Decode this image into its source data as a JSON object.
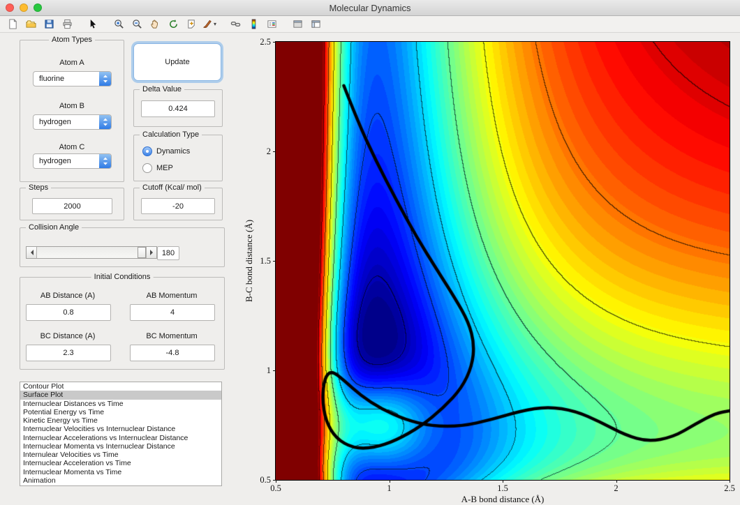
{
  "window": {
    "title": "Molecular Dynamics"
  },
  "toolbar": {
    "items": [
      {
        "name": "new-figure"
      },
      {
        "name": "open-file"
      },
      {
        "name": "save-figure"
      },
      {
        "name": "print-figure"
      },
      {
        "sep": true
      },
      {
        "name": "edit-plot"
      },
      {
        "sep": true
      },
      {
        "name": "zoom-in"
      },
      {
        "name": "zoom-out"
      },
      {
        "name": "pan"
      },
      {
        "name": "rotate-3d"
      },
      {
        "name": "data-cursor"
      },
      {
        "name": "brush",
        "caret": true
      },
      {
        "sep": true
      },
      {
        "name": "link-plots"
      },
      {
        "name": "insert-colorbar"
      },
      {
        "name": "insert-legend"
      },
      {
        "sep": true
      },
      {
        "name": "hide-plot-tools"
      },
      {
        "name": "show-plot-tools"
      }
    ]
  },
  "panels": {
    "atom_types": {
      "title": "Atom Types",
      "fields": [
        {
          "label": "Atom A",
          "value": "fluorine"
        },
        {
          "label": "Atom B",
          "value": "hydrogen"
        },
        {
          "label": "Atom C",
          "value": "hydrogen"
        }
      ]
    },
    "update_button": "Update",
    "delta": {
      "title": "Delta Value",
      "value": "0.424"
    },
    "calculation_type": {
      "title": "Calculation Type",
      "options": [
        {
          "label": "Dynamics",
          "selected": true
        },
        {
          "label": "MEP",
          "selected": false
        }
      ]
    },
    "steps": {
      "title": "Steps",
      "value": "2000"
    },
    "cutoff": {
      "title": "Cutoff (Kcal/ mol)",
      "value": "-20"
    },
    "collision_angle": {
      "title": "Collision Angle",
      "value": "180"
    },
    "initial_conditions": {
      "title": "Initial Conditions",
      "fields": [
        {
          "label": "AB Distance (A)",
          "value": "0.8"
        },
        {
          "label": "AB Momentum",
          "value": "4"
        },
        {
          "label": "BC Distance (A)",
          "value": "2.3"
        },
        {
          "label": "BC Momentum",
          "value": "-4.8"
        }
      ]
    },
    "plot_list": {
      "selected_index": 1,
      "items": [
        "Contour Plot",
        "Surface Plot",
        "Internuclear Distances vs Time",
        "Potential Energy vs Time",
        "Kinetic Energy vs Time",
        "Internuclear Velocities vs Internuclear Distance",
        "Internuclear Accelerations vs Internuclear Distance",
        "Internuclear Momenta vs Internuclear Distance",
        "Internulear Velocities vs Time",
        "Internuclear Acceleration vs Time",
        "Internuclear Momenta vs Time",
        "Animation"
      ]
    }
  },
  "chart_data": {
    "type": "heatmap",
    "style": "filled-contour-with-trajectory",
    "title": "",
    "xlabel": "A-B bond distance (Å)",
    "ylabel": "B-C bond distance (Å)",
    "xlim": [
      0.5,
      2.5
    ],
    "ylim": [
      0.5,
      2.5
    ],
    "xticks": [
      "0.5",
      "1",
      "1.5",
      "2",
      "2.5"
    ],
    "yticks": [
      "0.5",
      "1",
      "1.5",
      "2",
      "2.5"
    ],
    "colormap": "jet",
    "grid": false,
    "fill_bands": 48,
    "line_levels": [
      -180,
      -150,
      -120,
      -90,
      -60,
      -30,
      0
    ],
    "potential_model": {
      "description": "LEPS-like reactive potential energy surface: deep product valley along x≈0.95, shallower entrance valley along y≈0.74, repulsive walls at small distances, high plateau at large x and y, saddle near the corner",
      "D1": 140,
      "r1": 0.95,
      "a1": 3.0,
      "D2": 80,
      "r2": 0.74,
      "a2": 1.7,
      "barrier": 110,
      "sx": 0.17,
      "sy": 0.17,
      "tilt": 18,
      "vmin": -190,
      "vmax": 20
    },
    "trajectory": {
      "color": "#000000",
      "line_width": 4.5,
      "points": [
        [
          0.8,
          2.3
        ],
        [
          0.86,
          2.14
        ],
        [
          0.94,
          1.96
        ],
        [
          1.03,
          1.78
        ],
        [
          1.12,
          1.61
        ],
        [
          1.21,
          1.46
        ],
        [
          1.29,
          1.33
        ],
        [
          1.35,
          1.22
        ],
        [
          1.375,
          1.12
        ],
        [
          1.365,
          1.02
        ],
        [
          1.32,
          0.92
        ],
        [
          1.24,
          0.83
        ],
        [
          1.14,
          0.745
        ],
        [
          1.03,
          0.68
        ],
        [
          0.93,
          0.645
        ],
        [
          0.84,
          0.645
        ],
        [
          0.765,
          0.69
        ],
        [
          0.72,
          0.77
        ],
        [
          0.705,
          0.87
        ],
        [
          0.715,
          0.965
        ],
        [
          0.745,
          1.0
        ],
        [
          0.8,
          0.955
        ],
        [
          0.875,
          0.885
        ],
        [
          0.965,
          0.825
        ],
        [
          1.07,
          0.775
        ],
        [
          1.19,
          0.745
        ],
        [
          1.32,
          0.745
        ],
        [
          1.45,
          0.775
        ],
        [
          1.58,
          0.815
        ],
        [
          1.7,
          0.835
        ],
        [
          1.82,
          0.815
        ],
        [
          1.93,
          0.765
        ],
        [
          2.04,
          0.705
        ],
        [
          2.14,
          0.675
        ],
        [
          2.25,
          0.695
        ],
        [
          2.35,
          0.755
        ],
        [
          2.44,
          0.805
        ],
        [
          2.5,
          0.815
        ]
      ]
    }
  }
}
